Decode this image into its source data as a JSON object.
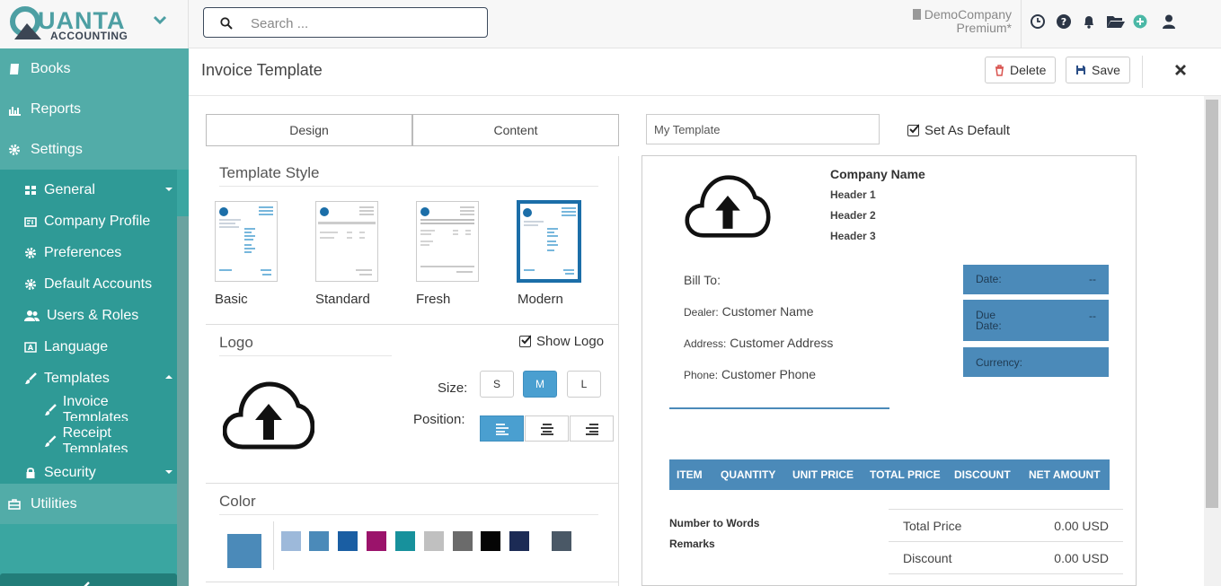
{
  "brand": {
    "name": "UANTA",
    "sub": "ACCOUNTING"
  },
  "search": {
    "placeholder": "Search ..."
  },
  "company": {
    "name": "DemoCompany",
    "plan": "Premium*"
  },
  "sidebar": {
    "books": "Books",
    "reports": "Reports",
    "settings": "Settings",
    "general": "General",
    "company_profile": "Company Profile",
    "preferences": "Preferences",
    "default_accounts": "Default Accounts",
    "users_roles": "Users & Roles",
    "language": "Language",
    "templates": "Templates",
    "invoice_templates": "Invoice Templates",
    "receipt_templates": "Receipt Templates",
    "security": "Security",
    "utilities": "Utilities"
  },
  "header": {
    "title": "Invoice Template",
    "delete": "Delete",
    "save": "Save"
  },
  "tabs": {
    "design": "Design",
    "content": "Content"
  },
  "template_name": {
    "value": "My Template"
  },
  "set_default": "Set As Default",
  "template_style": {
    "title": "Template Style",
    "styles": [
      "Basic",
      "Standard",
      "Fresh",
      "Modern"
    ],
    "selected": "Modern"
  },
  "logo": {
    "title": "Logo",
    "show_logo": "Show Logo",
    "size_label": "Size:",
    "sizes": [
      "S",
      "M",
      "L"
    ],
    "size_selected": "M",
    "position_label": "Position:",
    "position_selected": "left"
  },
  "color": {
    "title": "Color",
    "selected": "#4b8ab9",
    "swatches": [
      "#9db9da",
      "#4b8ab9",
      "#1a5ea3",
      "#9b136b",
      "#17919c",
      "#c0c0c0",
      "#6b6b6b",
      "#050505",
      "#1c2b55",
      "#4a5866"
    ]
  },
  "preview": {
    "company_name": "Company Name",
    "header1": "Header 1",
    "header2": "Header 2",
    "header3": "Header 3",
    "bill_to": "Bill To:",
    "dealer_label": "Dealer:",
    "dealer_value": "Customer Name",
    "address_label": "Address:",
    "address_value": "Customer Address",
    "phone_label": "Phone:",
    "phone_value": "Customer Phone",
    "date_label": "Date:",
    "date_value": "--",
    "due_label_1": "Due",
    "due_label_2": "Date:",
    "due_value": "--",
    "currency_label": "Currency:",
    "columns": [
      "ITEM",
      "QUANTITY",
      "UNIT PRICE",
      "TOTAL PRICE",
      "DISCOUNT",
      "NET AMOUNT"
    ],
    "number_to_words": "Number to Words",
    "remarks": "Remarks",
    "total_price_label": "Total Price",
    "total_price_value": "0.00 USD",
    "discount_label": "Discount",
    "discount_value": "0.00 USD"
  }
}
